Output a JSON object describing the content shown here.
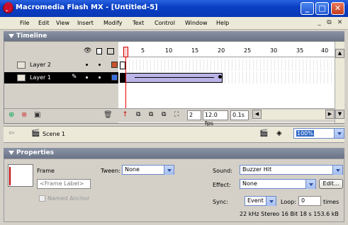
{
  "window": {
    "title": "Macromedia Flash MX - [Untitled-5]",
    "minimize": "_",
    "maximize": "□",
    "close": "✕"
  },
  "menu": [
    "File",
    "Edit",
    "View",
    "Insert",
    "Modify",
    "Text",
    "Control",
    "Window",
    "Help"
  ],
  "mdi": {
    "minimize": "_",
    "restore": "⧉",
    "close": "✕"
  },
  "timeline": {
    "label": "Timeline",
    "ruler_labels": [
      "1",
      "5",
      "10",
      "15",
      "20",
      "25",
      "30",
      "35",
      "40"
    ],
    "layers": [
      {
        "name": "Layer 2",
        "selected": false,
        "color": "#c8552a"
      },
      {
        "name": "Layer 1",
        "selected": true,
        "color": "#3b6fe0"
      }
    ],
    "current_frame": "2",
    "frame_rate": "12.0 fps",
    "elapsed_time": "0.1s"
  },
  "scene": {
    "name": "Scene 1",
    "zoom": "100%"
  },
  "properties": {
    "label": "Properties",
    "frame_label": "Frame",
    "frame_placeholder": "<Frame Label>",
    "named_anchor": "Named Anchor",
    "tween_label": "Tween:",
    "tween_value": "None",
    "sound_label": "Sound:",
    "sound_value": "Buzzer Hit",
    "effect_label": "Effect:",
    "effect_value": "None",
    "edit_button": "Edit...",
    "sync_label": "Sync:",
    "sync_value": "Event",
    "loop_label": "Loop:",
    "loop_value": "0",
    "times_label": "times",
    "sound_info": "22 kHz Stereo 16 Bit 18 s 153.6 kB"
  }
}
